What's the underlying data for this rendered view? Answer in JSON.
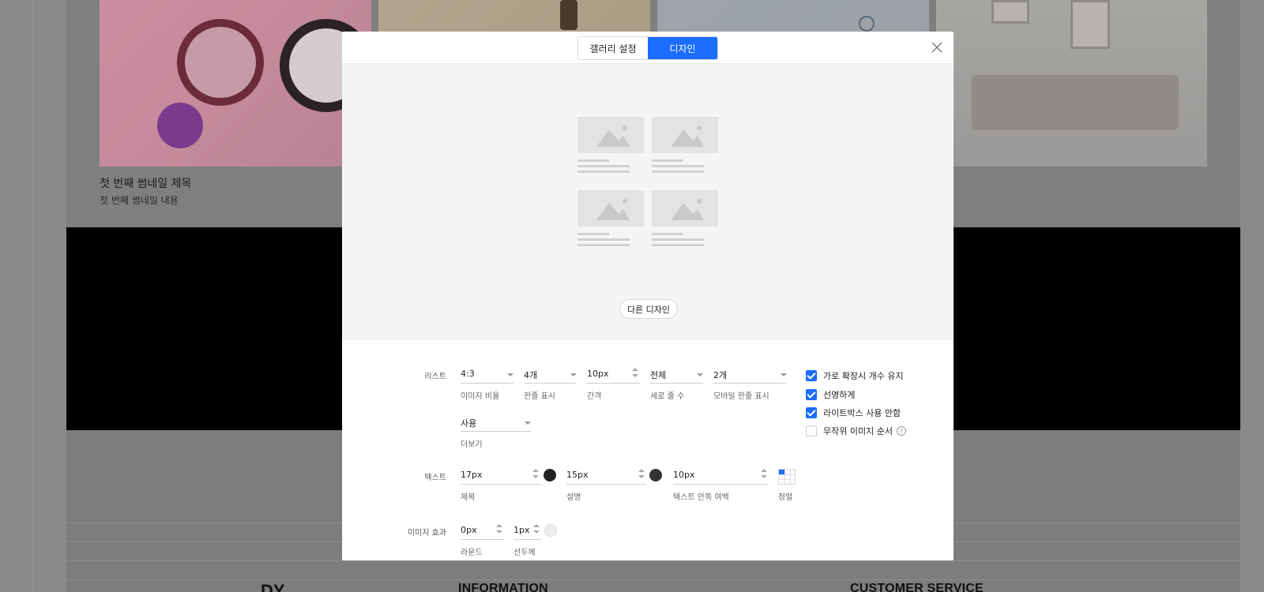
{
  "background": {
    "thumbnail_title": "첫 번째 썸네일 제목",
    "thumbnail_desc": "첫 번째 썸네일 내용",
    "footer_left_heading": "INFORMATION",
    "footer_right_heading": "CUSTOMER SERVICE",
    "footer_logo": "DY"
  },
  "modal": {
    "tabs": [
      {
        "label": "갤러리 설정",
        "active": false
      },
      {
        "label": "디자인",
        "active": true
      }
    ],
    "other_design_label": "다른 디자인",
    "list": {
      "label": "리스트",
      "ratio": {
        "value": "4:3",
        "label": "이미지 비율"
      },
      "per_row": {
        "value": "4개",
        "label": "한줄 표시"
      },
      "gap": {
        "value": "10px",
        "label": "간격"
      },
      "rows": {
        "value": "전체",
        "label": "세로 줄 수"
      },
      "mobile_per_row": {
        "value": "2개",
        "label": "모바일 한줄 표시"
      },
      "more": {
        "value": "사용",
        "label": "더보기"
      }
    },
    "checkboxes": [
      {
        "label": "가로 확장시 개수 유지",
        "checked": true
      },
      {
        "label": "선명하게",
        "checked": true
      },
      {
        "label": "라이트박스 사용 안함",
        "checked": true
      },
      {
        "label": "무작위 이미지 순서",
        "checked": false
      }
    ],
    "help_glyph": "?",
    "text": {
      "label": "텍스트",
      "title_size": {
        "value": "17px",
        "label": "제목",
        "color": "#222222"
      },
      "desc_size": {
        "value": "15px",
        "label": "설명",
        "color": "#333333"
      },
      "padding": {
        "value": "10px",
        "label": "텍스트 안쪽 여백"
      },
      "align_label": "정렬"
    },
    "image_effect": {
      "label": "이미지 효과",
      "round": {
        "value": "0px",
        "label": "라운드"
      },
      "border": {
        "value": "1px",
        "label": "선두께",
        "color": "#eeeeee"
      }
    }
  }
}
